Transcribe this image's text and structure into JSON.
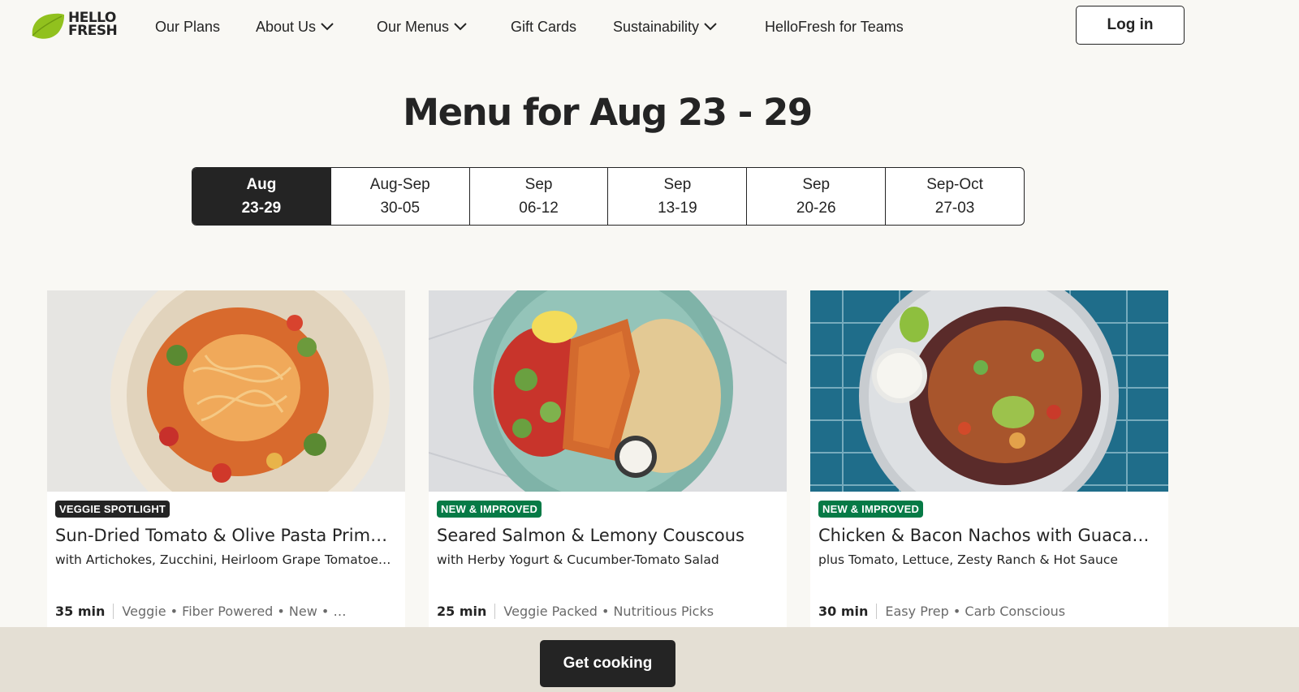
{
  "header": {
    "logo": {
      "line1": "HELLO",
      "line2": "FRESH",
      "leaf_color": "#91c11e"
    },
    "nav": [
      {
        "label": "Our Plans",
        "dropdown": false
      },
      {
        "label": "About Us",
        "dropdown": true
      },
      {
        "label": "Our Menus",
        "dropdown": true
      },
      {
        "label": "Gift Cards",
        "dropdown": false
      },
      {
        "label": "Sustainability",
        "dropdown": true
      },
      {
        "label": "HelloFresh for Teams",
        "dropdown": false
      }
    ],
    "login_label": "Log in"
  },
  "page_title": "Menu for Aug 23 - 29",
  "weeks": [
    {
      "month": "Aug",
      "days": "23-29",
      "selected": true
    },
    {
      "month": "Aug-Sep",
      "days": "30-05",
      "selected": false
    },
    {
      "month": "Sep",
      "days": "06-12",
      "selected": false
    },
    {
      "month": "Sep",
      "days": "13-19",
      "selected": false
    },
    {
      "month": "Sep",
      "days": "20-26",
      "selected": false
    },
    {
      "month": "Sep-Oct",
      "days": "27-03",
      "selected": false
    }
  ],
  "recipes": [
    {
      "badge": "VEGGIE SPOTLIGHT",
      "badge_color": "#242424",
      "title": "Sun-Dried Tomato & Olive Pasta Primavera",
      "subtitle": "with Artichokes, Zucchini, Heirloom Grape Tomatoes & Parmesan Crisps",
      "time": "35 min",
      "tags": "Veggie • Fiber Powered • New • …",
      "image_desc": "pasta-bowl"
    },
    {
      "badge": "NEW & IMPROVED",
      "badge_color": "#067a46",
      "title": "Seared Salmon & Lemony Couscous",
      "subtitle": "with Herby Yogurt & Cucumber-Tomato Salad",
      "time": "25 min",
      "tags": "Veggie Packed • Nutritious Picks",
      "image_desc": "salmon-bowl"
    },
    {
      "badge": "NEW & IMPROVED",
      "badge_color": "#067a46",
      "title": "Chicken & Bacon Nachos with Guacamole",
      "subtitle": "plus Tomato, Lettuce, Zesty Ranch & Hot Sauce",
      "time": "30 min",
      "tags": "Easy Prep • Carb Conscious",
      "image_desc": "nachos-plate"
    }
  ],
  "cta_label": "Get cooking",
  "colors": {
    "background": "#f9f8f4",
    "dark": "#242424",
    "green_badge": "#067a46",
    "bottom_bar": "#e4dfd4"
  }
}
